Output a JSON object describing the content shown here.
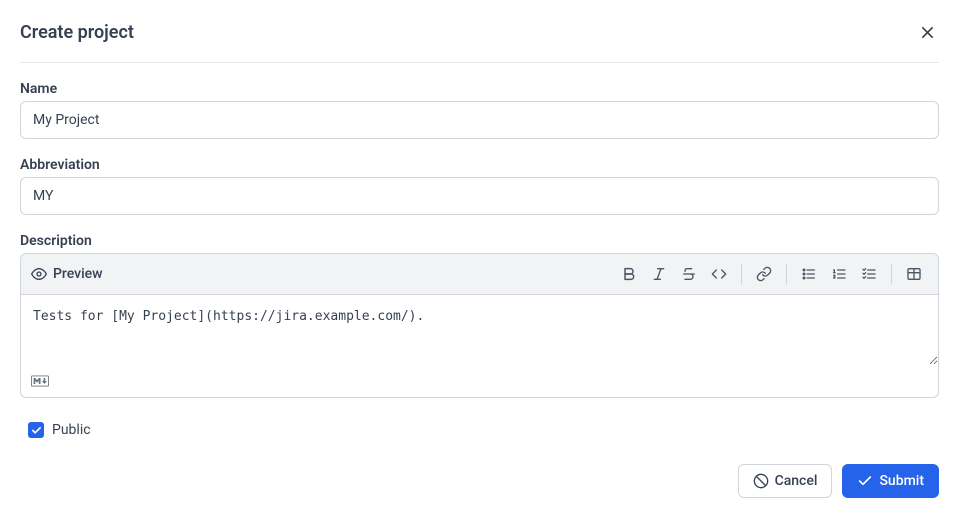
{
  "dialog": {
    "title": "Create project"
  },
  "fields": {
    "name": {
      "label": "Name",
      "value": "My Project"
    },
    "abbreviation": {
      "label": "Abbreviation",
      "value": "MY"
    },
    "description": {
      "label": "Description",
      "preview_label": "Preview",
      "value": "Tests for [My Project](https://jira.example.com/)."
    },
    "public": {
      "label": "Public",
      "checked": true
    }
  },
  "toolbar": {
    "bold": "bold-icon",
    "italic": "italic-icon",
    "strike": "strikethrough-icon",
    "code": "code-icon",
    "link": "link-icon",
    "ul": "bullet-list-icon",
    "ol": "numbered-list-icon",
    "task": "task-list-icon",
    "table": "table-icon"
  },
  "footer": {
    "cancel": "Cancel",
    "submit": "Submit"
  },
  "colors": {
    "primary": "#2563eb"
  }
}
